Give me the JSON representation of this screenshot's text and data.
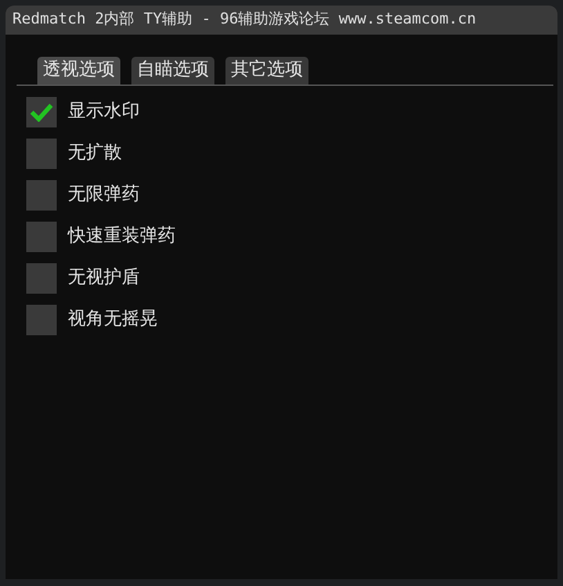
{
  "window": {
    "title": "Redmatch 2内部 TY辅助 - 96辅助游戏论坛 www.steamcom.cn"
  },
  "tabs": [
    {
      "label": "透视选项",
      "selected": true
    },
    {
      "label": "自瞄选项",
      "selected": false
    },
    {
      "label": "其它选项",
      "selected": false
    }
  ],
  "options": [
    {
      "label": "显示水印",
      "checked": true
    },
    {
      "label": "无扩散",
      "checked": false
    },
    {
      "label": "无限弹药",
      "checked": false
    },
    {
      "label": "快速重装弹药",
      "checked": false
    },
    {
      "label": "无视护盾",
      "checked": false
    },
    {
      "label": "视角无摇晃",
      "checked": false
    }
  ]
}
